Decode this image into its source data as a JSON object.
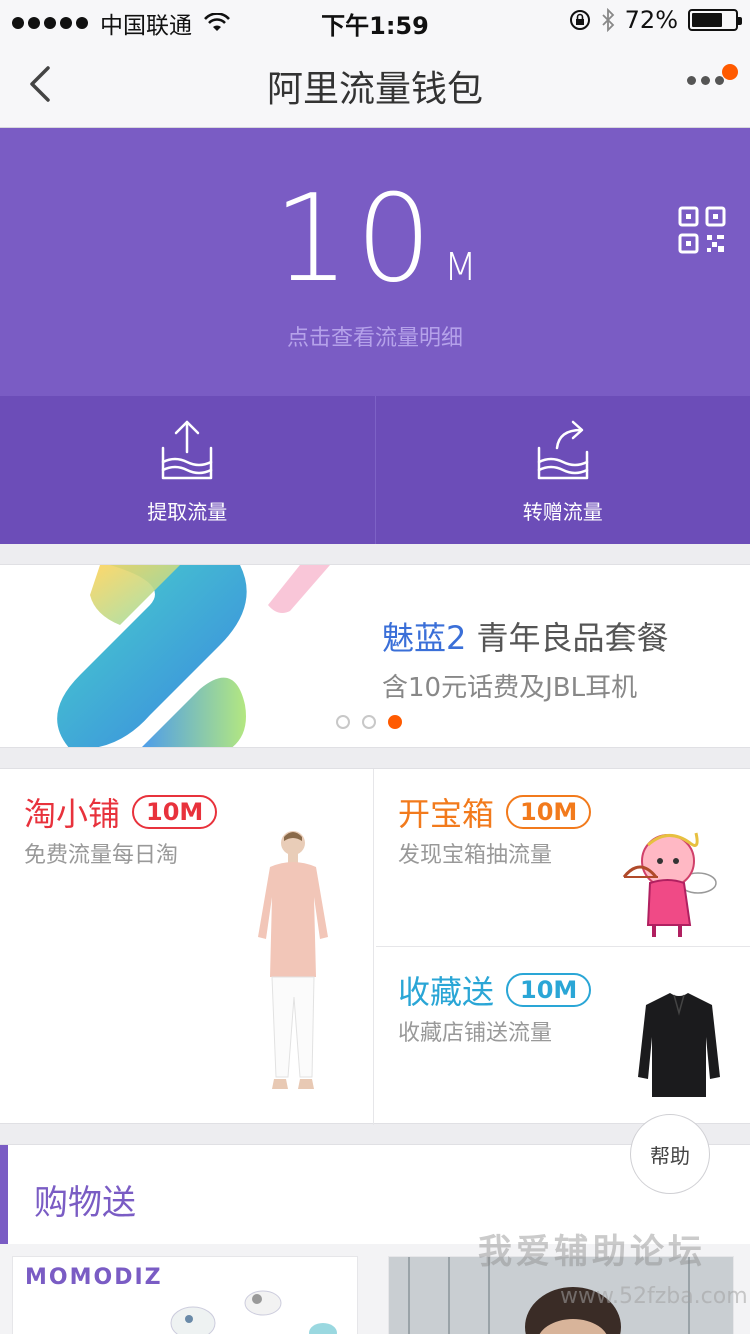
{
  "status_bar": {
    "carrier": "中国联通",
    "time": "下午1:59",
    "battery": "72%",
    "battery_level": 0.72
  },
  "nav": {
    "title": "阿里流量钱包"
  },
  "wallet": {
    "amount": "10",
    "unit": "M",
    "hint": "点击查看流量明细"
  },
  "actions": [
    {
      "label": "提取流量"
    },
    {
      "label": "转赠流量"
    }
  ],
  "banner": {
    "brand": "魅蓝2",
    "title_rest": " 青年良品套餐",
    "subtitle": "含10元话费及JBL耳机",
    "pager_count": 3,
    "pager_active": 3
  },
  "grid": {
    "left": {
      "title": "淘小铺",
      "badge": "10M",
      "subtitle": "免费流量每日淘",
      "color": "#e8323c"
    },
    "top_right": {
      "title": "开宝箱",
      "badge": "10M",
      "subtitle": "发现宝箱抽流量",
      "color": "#f27a1c"
    },
    "bottom_right": {
      "title": "收藏送",
      "badge": "10M",
      "subtitle": "收藏店铺送流量",
      "color": "#2aa6d6"
    }
  },
  "help": {
    "label": "帮助"
  },
  "section": {
    "title": "购物送"
  },
  "products": {
    "brand": "MOMODIZ"
  },
  "watermark": {
    "text": "我爱辅助论坛",
    "url": "www.52fzba.com"
  },
  "colors": {
    "accent": "#7a5cc4",
    "badge_dot": "#ff5a00"
  }
}
